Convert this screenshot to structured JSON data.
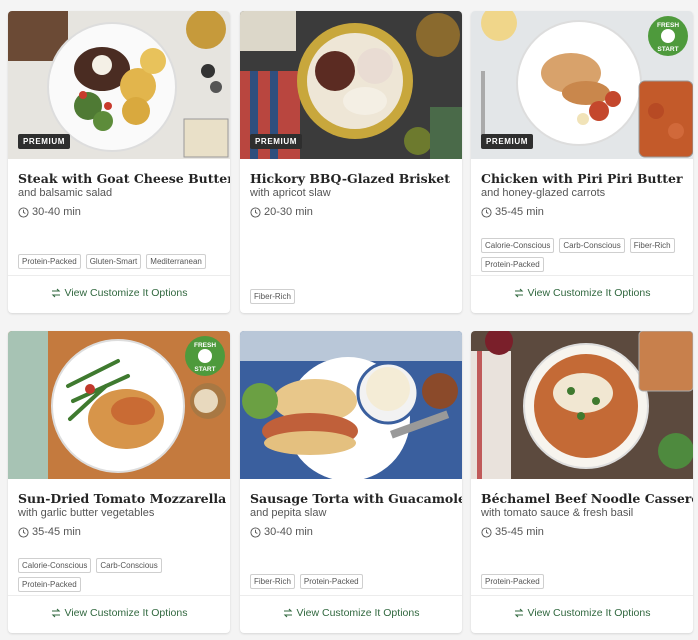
{
  "cards": [
    {
      "title": "Steak with Goat Cheese Butter",
      "subtitle": "and balsamic salad",
      "time": "30-40 min",
      "badge": "PREMIUM",
      "tags": [
        "Protein-Packed",
        "Gluten-Smart",
        "Mediterranean"
      ],
      "cta": "View Customize It Options"
    },
    {
      "title": "Hickory BBQ-Glazed Brisket",
      "subtitle": "with apricot slaw",
      "time": "20-30 min",
      "badge": "PREMIUM",
      "tags": [
        "Fiber-Rich"
      ],
      "cta": ""
    },
    {
      "title": "Chicken with Piri Piri Butter",
      "subtitle": "and honey-glazed carrots",
      "time": "35-45 min",
      "badge": "PREMIUM",
      "fresh_start": [
        "FRESH",
        "START"
      ],
      "tags": [
        "Calorie-Conscious",
        "Carb-Conscious",
        "Fiber-Rich",
        "Protein-Packed"
      ],
      "cta": "View Customize It Options"
    },
    {
      "title": "Sun-Dried Tomato Mozzarella Chicken",
      "subtitle": "with garlic butter vegetables",
      "time": "35-45 min",
      "fresh_start": [
        "FRESH",
        "START"
      ],
      "tags": [
        "Calorie-Conscious",
        "Carb-Conscious",
        "Protein-Packed"
      ],
      "cta": "View Customize It Options"
    },
    {
      "title": "Sausage Torta with Guacamole",
      "subtitle": "and pepita slaw",
      "time": "30-40 min",
      "tags": [
        "Fiber-Rich",
        "Protein-Packed"
      ],
      "cta": "View Customize It Options"
    },
    {
      "title": "Béchamel Beef Noodle Casserole",
      "subtitle": "with tomato sauce & fresh basil",
      "time": "35-45 min",
      "tags": [
        "Protein-Packed"
      ],
      "cta": "View Customize It Options"
    }
  ],
  "colors": {
    "accent": "#31683f",
    "badge_bg": "#2e2e2e",
    "fresh_green": "#4e9a3c"
  }
}
